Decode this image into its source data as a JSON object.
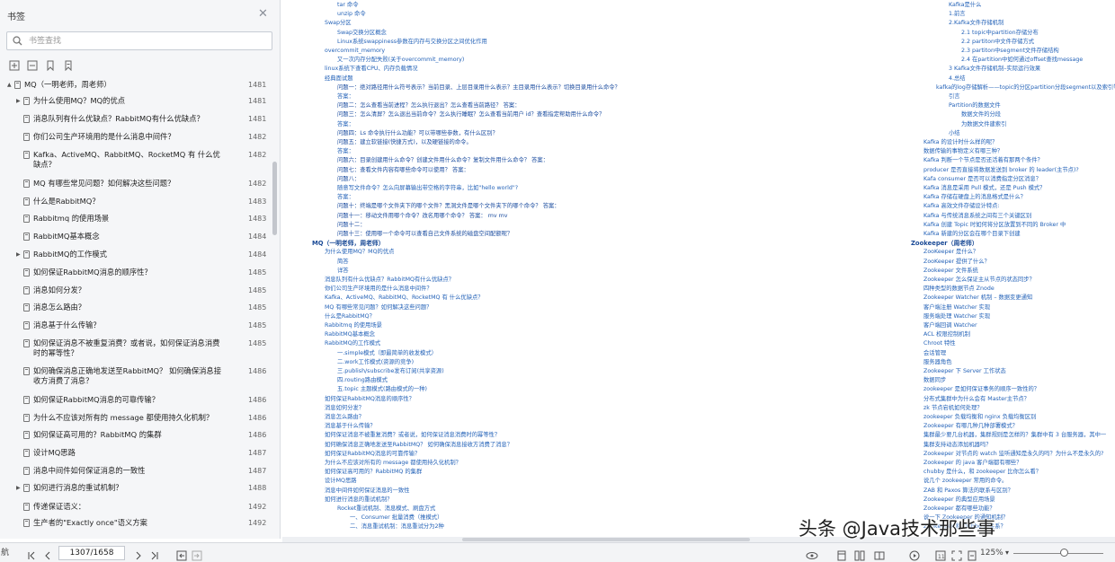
{
  "sidebar": {
    "title": "书签",
    "search_placeholder": "书签查找",
    "items": [
      {
        "label": "MQ（一明老师，周老师）",
        "page": "1481",
        "level": 0,
        "arrow": "▲"
      },
      {
        "label": "为什么使用MQ？MQ的优点",
        "page": "1481",
        "level": 1,
        "arrow": "▶"
      },
      {
        "label": "消息队列有什么优缺点？RabbitMQ有什么优缺点？",
        "page": "1481",
        "level": 1,
        "arrow": ""
      },
      {
        "label": "你们公司生产环境用的是什么消息中间件？",
        "page": "1482",
        "level": 1,
        "arrow": ""
      },
      {
        "label": "Kafka、ActiveMQ、RabbitMQ、RocketMQ 有 什么优缺点？",
        "page": "1482",
        "level": 1,
        "arrow": ""
      },
      {
        "label": "MQ 有哪些常见问题？如何解决这些问题？",
        "page": "1482",
        "level": 1,
        "arrow": ""
      },
      {
        "label": "什么是RabbitMQ？",
        "page": "1483",
        "level": 1,
        "arrow": ""
      },
      {
        "label": "Rabbitmq 的使用场景",
        "page": "1483",
        "level": 1,
        "arrow": ""
      },
      {
        "label": "RabbitMQ基本概念",
        "page": "1484",
        "level": 1,
        "arrow": ""
      },
      {
        "label": "RabbitMQ的工作模式",
        "page": "1484",
        "level": 1,
        "arrow": "▶"
      },
      {
        "label": "如何保证RabbitMQ消息的顺序性？",
        "page": "1485",
        "level": 1,
        "arrow": ""
      },
      {
        "label": "消息如何分发？",
        "page": "1485",
        "level": 1,
        "arrow": ""
      },
      {
        "label": "消息怎么路由？",
        "page": "1485",
        "level": 1,
        "arrow": ""
      },
      {
        "label": "消息基于什么传输？",
        "page": "1485",
        "level": 1,
        "arrow": ""
      },
      {
        "label": "如何保证消息不被重复消费？或者说，如何保证消息消费时的幂等性？",
        "page": "1485",
        "level": 1,
        "arrow": ""
      },
      {
        "label": "如何确保消息正确地发送至RabbitMQ？ 如何确保消息接收方消费了消息？",
        "page": "1486",
        "level": 1,
        "arrow": ""
      },
      {
        "label": "如何保证RabbitMQ消息的可靠传输？",
        "page": "1486",
        "level": 1,
        "arrow": ""
      },
      {
        "label": "为什么不应该对所有的 message 都使用持久化机制？",
        "page": "1486",
        "level": 1,
        "arrow": ""
      },
      {
        "label": "如何保证高可用的？RabbitMQ 的集群",
        "page": "1486",
        "level": 1,
        "arrow": ""
      },
      {
        "label": "设计MQ思路",
        "page": "1487",
        "level": 1,
        "arrow": ""
      },
      {
        "label": "消息中间件如何保证消息的一致性",
        "page": "1487",
        "level": 1,
        "arrow": ""
      },
      {
        "label": "如何进行消息的重试机制？",
        "page": "1488",
        "level": 1,
        "arrow": "▶"
      },
      {
        "label": "传递保证语义：",
        "page": "1492",
        "level": 1,
        "arrow": ""
      },
      {
        "label": "生产者的\"Exactly once\"语义方案",
        "page": "1492",
        "level": 1,
        "arrow": ""
      }
    ]
  },
  "document": {
    "col1": [
      {
        "t": "tar 命令",
        "i": 2
      },
      {
        "t": "unzip 命令",
        "i": 2
      },
      {
        "t": "Swap分区",
        "i": 1
      },
      {
        "t": "Swap交换分区概念",
        "i": 2
      },
      {
        "t": "Linux系统swappiness参数在内存与交换分区之间优化作用",
        "i": 2
      },
      {
        "t": "overcommit_memory",
        "i": 1
      },
      {
        "t": "又一次内存分配失败(关于overcommit_memory)",
        "i": 2
      },
      {
        "t": "linux系统下查看CPU、内存负载情况",
        "i": 1
      },
      {
        "t": "经典面试题",
        "i": 1
      },
      {
        "t": "问题一：绝对路径用什么符号表示？当前目录、上层目录用什么表示？主目录用什么表示？切换目录用什么命令？",
        "i": 2,
        "q": 1
      },
      {
        "t": "答案：",
        "i": 2
      },
      {
        "t": "问题二：怎么查看当前进程？怎么执行退出？怎么查看当前路径？ 答案：",
        "i": 2,
        "q": 1
      },
      {
        "t": "问题三：怎么清屏？怎么退出当前命令？怎么执行睡眠？怎么查看当前用户 id？查看指定帮助用什么命令？",
        "i": 2,
        "q": 1
      },
      {
        "t": "答案：",
        "i": 2
      },
      {
        "t": "问题四：Ls 命令执行什么功能？可以带哪些参数，有什么区别？",
        "i": 2,
        "q": 1
      },
      {
        "t": "问题五：建立软链接(快捷方式)，以及硬链接的命令。",
        "i": 2,
        "q": 1
      },
      {
        "t": "答案：",
        "i": 2
      },
      {
        "t": "问题六：目录创建用什么命令？创建文件用什么命令？复制文件用什么命令？ 答案：",
        "i": 2,
        "q": 1
      },
      {
        "t": "问题七：查看文件内容有哪些命令可以使用？ 答案：",
        "i": 2,
        "q": 1
      },
      {
        "t": "问题八：",
        "i": 2,
        "q": 1
      },
      {
        "t": "随意写文件命令？怎么向屏幕输出带空格的字符串，比如\"hello world\"?",
        "i": 2
      },
      {
        "t": "答案：",
        "i": 2
      },
      {
        "t": "问题十：终端是哪个文件夹下的哪个文件？黑洞文件是哪个文件夹下的哪个命令？ 答案：",
        "i": 2,
        "q": 1
      },
      {
        "t": "问题十一：移动文件用哪个命令？改名用哪个命令？ 答案： mv mv",
        "i": 2,
        "q": 1
      },
      {
        "t": "问题十二：",
        "i": 2,
        "q": 1
      },
      {
        "t": "问题十三：使用哪一个命令可以查看自己文件系统的磁盘空间配额呢？",
        "i": 2,
        "q": 1
      },
      {
        "t": "MQ（一明老师，周老师）",
        "i": 0,
        "h": 1
      },
      {
        "t": "为什么使用MQ？MQ的优点",
        "i": 1
      },
      {
        "t": "简答",
        "i": 2
      },
      {
        "t": "详答",
        "i": 2
      },
      {
        "t": "消息队列有什么优缺点？RabbitMQ有什么优缺点？",
        "i": 1
      },
      {
        "t": "你们公司生产环境用的是什么消息中间件？",
        "i": 1
      },
      {
        "t": "Kafka、ActiveMQ、RabbitMQ、RocketMQ 有 什么优缺点？",
        "i": 1
      },
      {
        "t": "MQ 有哪些常见问题？如何解决这些问题？",
        "i": 1
      },
      {
        "t": "什么是RabbitMQ？",
        "i": 1
      },
      {
        "t": "Rabbitmq 的使用场景",
        "i": 1
      },
      {
        "t": "RabbitMQ基本概念",
        "i": 1
      },
      {
        "t": "RabbitMQ的工作模式",
        "i": 1
      },
      {
        "t": "一.simple模式（即最简单的收发模式）",
        "i": 2
      },
      {
        "t": "二.work工作模式(资源的竞争)",
        "i": 2
      },
      {
        "t": "三.publish/subscribe发布订阅(共享资源)",
        "i": 2
      },
      {
        "t": "四.routing路由模式",
        "i": 2
      },
      {
        "t": "五.topic 主题模式(路由模式的一种)",
        "i": 2
      },
      {
        "t": "如何保证RabbitMQ消息的顺序性？",
        "i": 1
      },
      {
        "t": "消息如何分发？",
        "i": 1
      },
      {
        "t": "消息怎么路由？",
        "i": 1
      },
      {
        "t": "消息基于什么传输？",
        "i": 1
      },
      {
        "t": "如何保证消息不被重复消费？或者说，如何保证消息消费时的幂等性？",
        "i": 1
      },
      {
        "t": "如何确保消息正确地发送至RabbitMQ？ 如何确保消息接收方消费了消息？",
        "i": 1
      },
      {
        "t": "如何保证RabbitMQ消息的可靠传输？",
        "i": 1
      },
      {
        "t": "为什么不应该对所有的 message 都使用持久化机制？",
        "i": 1
      },
      {
        "t": "如何保证高可用的？RabbitMQ 的集群",
        "i": 1
      },
      {
        "t": "设计MQ思路",
        "i": 1
      },
      {
        "t": "消息中间件如何保证消息的一致性",
        "i": 1
      },
      {
        "t": "如何进行消息的重试机制？",
        "i": 1
      },
      {
        "t": "Rocket重试机制、消息模式、刷盘方式",
        "i": 2
      },
      {
        "t": "一、Consumer 批量消费（推模式）",
        "i": 3
      },
      {
        "t": "二、消息重试机制：消息重试分为2种",
        "i": 3
      }
    ],
    "col2": [
      {
        "t": "Kafka是什么",
        "i": 2
      },
      {
        "t": "1.前言",
        "i": 2
      },
      {
        "t": "2.Kafka文件存储机制",
        "i": 2
      },
      {
        "t": "2.1 topic中partition存储分布",
        "i": 3
      },
      {
        "t": "2.2 partiton中文件存储方式",
        "i": 3
      },
      {
        "t": "2.3 partiton中segment文件存储结构",
        "i": 3
      },
      {
        "t": "2.4 在partition中如何通过offset查找message",
        "i": 3
      },
      {
        "t": "3 Kafka文件存储机制–实际运行效果",
        "i": 2
      },
      {
        "t": "4.总结",
        "i": 2
      },
      {
        "t": "kafka的log存储解析——topic的分区partition分段segment以及索引等",
        "i": 1
      },
      {
        "t": "引言",
        "i": 2
      },
      {
        "t": "Partition的数据文件",
        "i": 2
      },
      {
        "t": "数据文件的分段",
        "i": 3
      },
      {
        "t": "为数据文件建索引",
        "i": 3
      },
      {
        "t": "小结",
        "i": 2
      },
      {
        "t": "Kafka 的设计时什么样的呢？",
        "i": 0
      },
      {
        "t": "数据传输的事物定义有哪三种？",
        "i": 0
      },
      {
        "t": "Kafka 判断一个节点是否还活着有那两个条件？",
        "i": 0
      },
      {
        "t": "producer 是否直接将数据发送到 broker 的 leader(主节点)?",
        "i": 0
      },
      {
        "t": "Kafa consumer 是否可以消费指定分区消息？",
        "i": 0
      },
      {
        "t": "Kafka 消息是采用 Pull 模式，还是 Push 模式？",
        "i": 0
      },
      {
        "t": "Kafka 存储在硬盘上的消息格式是什么？",
        "i": 0
      },
      {
        "t": "Kafka 高效文件存储设计特点:",
        "i": 0
      },
      {
        "t": "Kafka 与传统消息系统之间有三个关键区别",
        "i": 0
      },
      {
        "t": "Kafka 创建 Topic 时如何将分区放置到不同的 Broker 中",
        "i": 0
      },
      {
        "t": "Kafka 新建的分区会在哪个目录下创建",
        "i": 0
      },
      {
        "t": "Zookeeper（周老师）",
        "i": -1,
        "h": 1
      },
      {
        "t": "ZooKeeper 是什么？",
        "i": 0
      },
      {
        "t": "ZooKeeper 提供了什么？",
        "i": 0
      },
      {
        "t": "Zookeeper 文件系统",
        "i": 0
      },
      {
        "t": "Zookeeper 怎么保证主从节点的状态同步？",
        "i": 0
      },
      {
        "t": "四种类型的数据节点 Znode",
        "i": 0
      },
      {
        "t": "Zookeeper Watcher 机制 – 数据变更通知",
        "i": 0
      },
      {
        "t": "客户端注册 Watcher 实现",
        "i": 0
      },
      {
        "t": "服务端处理 Watcher 实现",
        "i": 0
      },
      {
        "t": "客户端回调 Watcher",
        "i": 0
      },
      {
        "t": "ACL 权限控制机制",
        "i": 0
      },
      {
        "t": "Chroot 特性",
        "i": 0
      },
      {
        "t": "会话管理",
        "i": 0
      },
      {
        "t": "服务器角色",
        "i": 0
      },
      {
        "t": "Zookeeper 下 Server 工作状态",
        "i": 0
      },
      {
        "t": "数据同步",
        "i": 0
      },
      {
        "t": "zookeeper 是如何保证事务的顺序一致性的？",
        "i": 0
      },
      {
        "t": "分布式集群中为什么会有 Master主节点？",
        "i": 0
      },
      {
        "t": "zk 节点宕机如何处理？",
        "i": 0
      },
      {
        "t": "zookeeper 负载均衡和 nginx 负载均衡区别",
        "i": 0
      },
      {
        "t": "Zookeeper 有哪几种几种部署模式？",
        "i": 0
      },
      {
        "t": "集群最少要几台机器，集群规则是怎样的？集群中有 3 台服务器，其中一",
        "i": 0
      },
      {
        "t": "集群支持动态添加机器吗？",
        "i": 0
      },
      {
        "t": "Zookeeper 对节点的 watch 监听通知是永久的吗？为什么不是永久的?",
        "i": 0
      },
      {
        "t": "Zookeeper 的 java 客户端都有哪些？",
        "i": 0
      },
      {
        "t": "chubby 是什么，和 zookeeper 比你怎么看？",
        "i": 0
      },
      {
        "t": "说几个 zookeeper 常用的命令。",
        "i": 0
      },
      {
        "t": "ZAB 和 Paxos 算法的联系与区别？",
        "i": 0
      },
      {
        "t": "Zookeeper 的典型应用场景",
        "i": 0
      },
      {
        "t": "Zookeeper 都有哪些功能？",
        "i": 0
      },
      {
        "t": "说一下 Zookeeper 的通知机制？",
        "i": 0
      },
      {
        "t": "Zookeeper 和 Dubbo 的关系？",
        "i": 0
      }
    ]
  },
  "bottom": {
    "nav_label": "航",
    "page_indicator": "1307/1658",
    "zoom": "125%",
    "zoom_level": 0.57
  },
  "watermark": "头条 @Java技术那些事"
}
